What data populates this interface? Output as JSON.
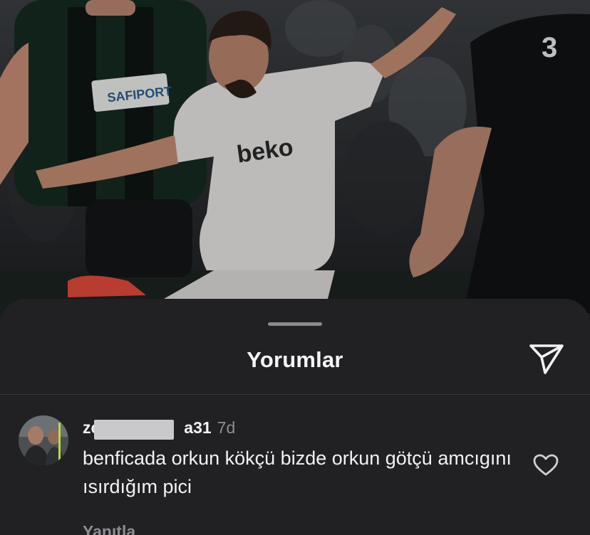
{
  "post": {
    "image_name": "football-match-photo",
    "sponsor_chest": "beko",
    "sponsor_opponent": "SAFIPORT"
  },
  "sheet": {
    "title": "Yorumlar",
    "share_icon": "paper-plane-icon"
  },
  "comment": {
    "username_visible": "zc         a31",
    "username_prefix": "zc",
    "username_suffix": "a31",
    "time": "7d",
    "text": "benficada orkun kökçü bizde orkun götçü amcıgını ısırdığım pici",
    "reply_label": "Yanıtla",
    "like_icon": "heart-outline-icon"
  },
  "colors": {
    "sheet_bg": "#212124",
    "text_primary": "#f2f2f4",
    "text_secondary": "#8d8d92",
    "divider": "#38383b"
  }
}
